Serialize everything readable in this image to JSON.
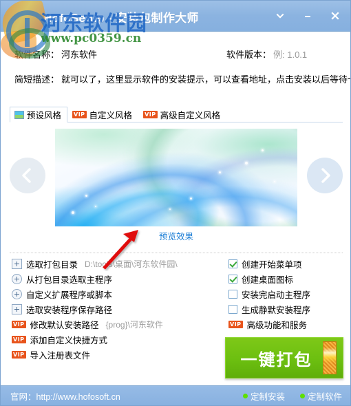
{
  "window": {
    "title": "HofoSetup - 安装包制作大师",
    "controls": [
      {
        "name": "menu-chevron",
        "icon": "chevron-down-icon"
      },
      {
        "name": "minimize",
        "icon": "minimize-icon"
      },
      {
        "name": "close",
        "icon": "close-icon"
      }
    ]
  },
  "watermark": {
    "text_cn": "河东软件园",
    "url": "www.pc0359.cn"
  },
  "form": {
    "name_label": "软件名称：",
    "name_value": "河东软件",
    "version_label": "软件版本：",
    "version_placeholder": "例: 1.0.1",
    "desc_label": "简短描述：",
    "desc_value": "就可以了，这里显示软件的安装提示，可以查看地址，点击安装以后等待十"
  },
  "tabs": [
    {
      "label": "预设风格",
      "icon": "preset-style-icon",
      "vip": false,
      "active": true
    },
    {
      "label": "自定义风格",
      "icon": "vip-badge-icon",
      "vip": true,
      "active": false
    },
    {
      "label": "高级自定义风格",
      "icon": "vip-badge-icon",
      "vip": true,
      "active": false
    }
  ],
  "carousel": {
    "prev_label": "上一个",
    "next_label": "下一个",
    "preview_link": "预览效果"
  },
  "options_left": [
    {
      "label": "选取打包目录",
      "sub": "D:\\tools\\桌面\\河东软件园\\",
      "icon": "square-plus-icon",
      "vip": false
    },
    {
      "label": "从打包目录选取主程序",
      "sub": "",
      "icon": "circle-plus-icon",
      "vip": false
    },
    {
      "label": "自定义扩展程序或脚本",
      "sub": "",
      "icon": "circle-plus-icon",
      "vip": false
    },
    {
      "label": "选取安装程序保存路径",
      "sub": "",
      "icon": "square-plus-icon",
      "vip": false
    },
    {
      "label": "修改默认安装路径",
      "sub": "{prog}\\河东软件",
      "icon": "vip-badge-icon",
      "vip": true
    },
    {
      "label": "添加自定义快捷方式",
      "sub": "",
      "icon": "vip-badge-icon",
      "vip": true
    },
    {
      "label": "导入注册表文件",
      "sub": "",
      "icon": "vip-badge-icon",
      "vip": true
    }
  ],
  "options_right": [
    {
      "label": "创建开始菜单项",
      "checked": true,
      "vip": false
    },
    {
      "label": "创建桌面图标",
      "checked": true,
      "vip": false
    },
    {
      "label": "安装完启动主程序",
      "checked": false,
      "vip": false
    },
    {
      "label": "生成静默安装程序",
      "checked": false,
      "vip": false
    },
    {
      "label": "高级功能和服务",
      "checked": false,
      "vip": true
    }
  ],
  "pack_button": {
    "label": "一键打包"
  },
  "footer": {
    "site": "官网：http://www.hofosoft.cn",
    "links": [
      {
        "label": "定制安装"
      },
      {
        "label": "定制软件"
      }
    ]
  },
  "vip_text": "VIP",
  "colors": {
    "titlebar": "#8bb3e0",
    "accent_green": "#6cbf10",
    "vip_orange": "#e8541c",
    "link_blue": "#1e7fd6",
    "check_green": "#3aa93a"
  }
}
